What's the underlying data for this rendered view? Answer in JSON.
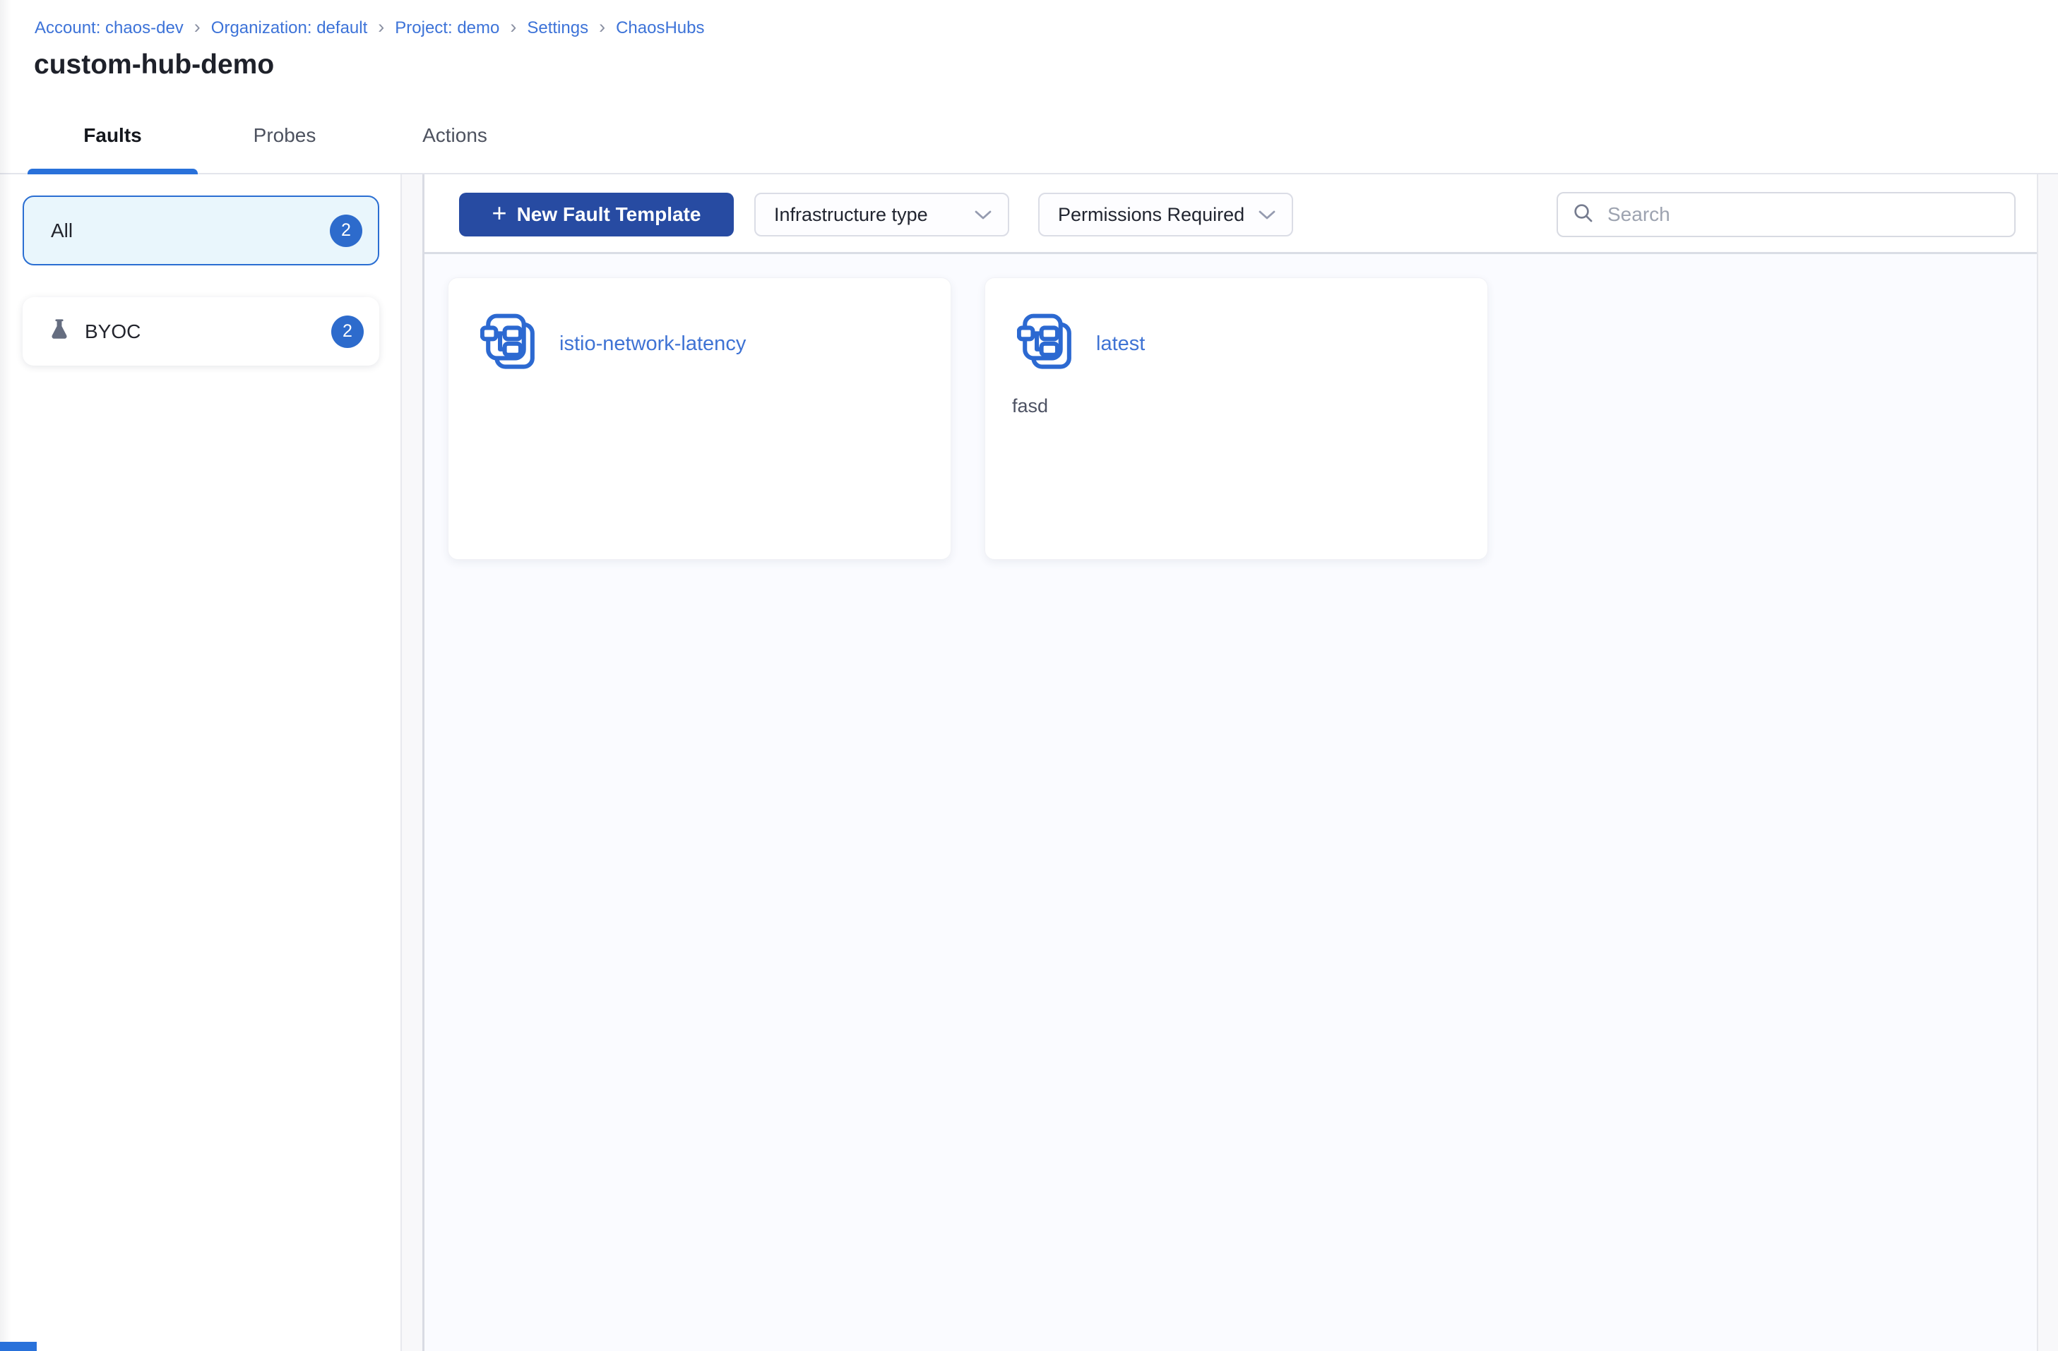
{
  "breadcrumb": {
    "separator": "›",
    "items": [
      {
        "label": "Account: chaos-dev"
      },
      {
        "label": "Organization: default"
      },
      {
        "label": "Project: demo"
      },
      {
        "label": "Settings"
      },
      {
        "label": "ChaosHubs"
      }
    ]
  },
  "page": {
    "title": "custom-hub-demo"
  },
  "tabs": [
    {
      "label": "Faults"
    },
    {
      "label": "Probes"
    },
    {
      "label": "Actions"
    }
  ],
  "sidebar": {
    "items": [
      {
        "label": "All",
        "count": "2"
      },
      {
        "label": "BYOC",
        "count": "2",
        "icon": "flask-icon"
      }
    ]
  },
  "toolbar": {
    "new_template_button": {
      "plus": "+",
      "label": "New Fault Template"
    },
    "infrastructure_dropdown": {
      "label": "Infrastructure type"
    },
    "permissions_dropdown": {
      "label": "Permissions Required"
    },
    "search": {
      "placeholder": "Search"
    }
  },
  "cards": [
    {
      "title": "istio-network-latency"
    },
    {
      "title": "latest",
      "description": "fasd"
    }
  ],
  "colors": {
    "primary_button": "#274ba2",
    "link_blue": "#3d73d8",
    "badge_blue": "#2d6bcc",
    "tab_underline": "#2971da",
    "selected_filter_bg": "#e9f6fc",
    "selected_filter_border": "#2a6ed2",
    "icon_blue": "#2c69d1"
  }
}
